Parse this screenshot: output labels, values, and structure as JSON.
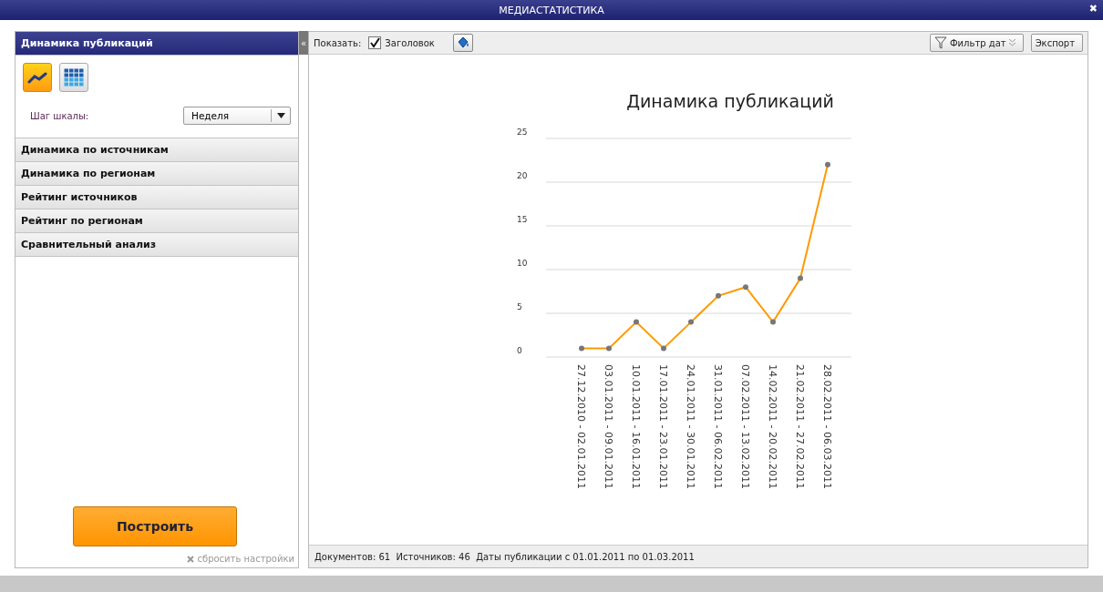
{
  "window": {
    "title": "МЕДИАСТАТИСТИКА",
    "close": "✖"
  },
  "sidebar": {
    "collapse": "«",
    "sections": [
      {
        "label": "Динамика публикаций",
        "expanded": true
      },
      {
        "label": "Динамика по источникам",
        "expanded": false
      },
      {
        "label": "Динамика по регионам",
        "expanded": false
      },
      {
        "label": "Рейтинг источников",
        "expanded": false
      },
      {
        "label": "Рейтинг по регионам",
        "expanded": false
      },
      {
        "label": "Сравнительный анализ",
        "expanded": false
      }
    ],
    "view_types": [
      {
        "kind": "line",
        "selected": true
      },
      {
        "kind": "table",
        "selected": false
      }
    ],
    "scale_label": "Шаг шкалы:",
    "scale_value": "Неделя",
    "build_button": "Построить",
    "reset_link": "сбросить настройки"
  },
  "toolbar": {
    "show_label": "Показать:",
    "title_checkbox": {
      "label": "Заголовок",
      "checked": true
    },
    "date_filter": "Фильтр дат",
    "export": "Экспорт"
  },
  "chart": {
    "chart_data": {
      "type": "line",
      "title": "Динамика публикаций",
      "categories": [
        "27.12.2010 - 02.01.2011",
        "03.01.2011 - 09.01.2011",
        "10.01.2011 - 16.01.2011",
        "17.01.2011 - 23.01.2011",
        "24.01.2011 - 30.01.2011",
        "31.01.2011 - 06.02.2011",
        "07.02.2011 - 13.02.2011",
        "14.02.2011 - 20.02.2011",
        "21.02.2011 - 27.02.2011",
        "28.02.2011 - 06.03.2011"
      ],
      "series": [
        {
          "color": "#ff9900",
          "marker": true,
          "values": [
            1,
            1,
            4,
            1,
            4,
            7,
            8,
            4,
            9,
            22
          ]
        }
      ],
      "grid": true,
      "ylim": [
        0,
        25
      ],
      "yticks": [
        0,
        5,
        10,
        15,
        20,
        25
      ]
    }
  },
  "status_bar": "Документов: 61  Источников: 46  Даты публикации с 01.01.2011 по 01.03.2011"
}
